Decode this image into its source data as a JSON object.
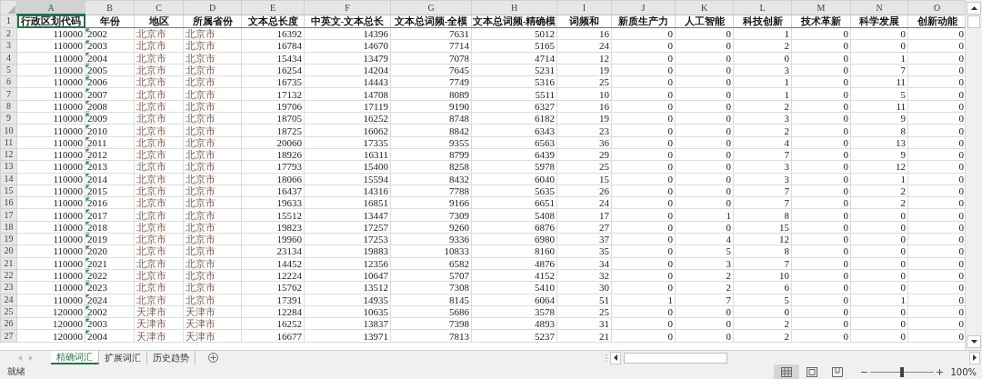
{
  "columns": [
    {
      "letter": "A",
      "selected": true
    },
    {
      "letter": "B",
      "selected": false
    },
    {
      "letter": "C",
      "selected": false
    },
    {
      "letter": "D",
      "selected": false
    },
    {
      "letter": "E",
      "selected": false
    },
    {
      "letter": "F",
      "selected": false
    },
    {
      "letter": "G",
      "selected": false
    },
    {
      "letter": "H",
      "selected": false
    },
    {
      "letter": "I",
      "selected": false
    },
    {
      "letter": "J",
      "selected": false
    },
    {
      "letter": "K",
      "selected": false
    },
    {
      "letter": "L",
      "selected": false
    },
    {
      "letter": "M",
      "selected": false
    },
    {
      "letter": "N",
      "selected": false
    },
    {
      "letter": "O",
      "selected": false
    }
  ],
  "header_row": {
    "num": "1",
    "cells": [
      "行政区划代码",
      "年份",
      "地区",
      "所属省份",
      "文本总长度",
      "中英文-文本总长",
      "文本总词频-全模",
      "文本总词频-精确模",
      "词频和",
      "新质生产力",
      "人工智能",
      "科技创新",
      "技术革新",
      "科学发展",
      "创新动能"
    ]
  },
  "rows": [
    {
      "num": "2",
      "cells": [
        "110000",
        "2002",
        "北京市",
        "北京市",
        "16392",
        "14396",
        "7631",
        "5012",
        "16",
        "0",
        "0",
        "1",
        "0",
        "0",
        "0"
      ]
    },
    {
      "num": "3",
      "cells": [
        "110000",
        "2003",
        "北京市",
        "北京市",
        "16784",
        "14670",
        "7714",
        "5165",
        "24",
        "0",
        "0",
        "2",
        "0",
        "0",
        "0"
      ]
    },
    {
      "num": "4",
      "cells": [
        "110000",
        "2004",
        "北京市",
        "北京市",
        "15434",
        "13479",
        "7078",
        "4714",
        "12",
        "0",
        "0",
        "0",
        "0",
        "1",
        "0"
      ]
    },
    {
      "num": "5",
      "cells": [
        "110000",
        "2005",
        "北京市",
        "北京市",
        "16254",
        "14204",
        "7645",
        "5231",
        "19",
        "0",
        "0",
        "3",
        "0",
        "7",
        "0"
      ]
    },
    {
      "num": "6",
      "cells": [
        "110000",
        "2006",
        "北京市",
        "北京市",
        "16735",
        "14443",
        "7749",
        "5316",
        "25",
        "0",
        "0",
        "1",
        "0",
        "11",
        "0"
      ]
    },
    {
      "num": "7",
      "cells": [
        "110000",
        "2007",
        "北京市",
        "北京市",
        "17132",
        "14708",
        "8089",
        "5511",
        "10",
        "0",
        "0",
        "1",
        "0",
        "5",
        "0"
      ]
    },
    {
      "num": "8",
      "cells": [
        "110000",
        "2008",
        "北京市",
        "北京市",
        "19706",
        "17119",
        "9190",
        "6327",
        "16",
        "0",
        "0",
        "2",
        "0",
        "11",
        "0"
      ]
    },
    {
      "num": "9",
      "cells": [
        "110000",
        "2009",
        "北京市",
        "北京市",
        "18705",
        "16252",
        "8748",
        "6182",
        "19",
        "0",
        "0",
        "3",
        "0",
        "9",
        "0"
      ]
    },
    {
      "num": "10",
      "cells": [
        "110000",
        "2010",
        "北京市",
        "北京市",
        "18725",
        "16062",
        "8842",
        "6343",
        "23",
        "0",
        "0",
        "2",
        "0",
        "8",
        "0"
      ]
    },
    {
      "num": "11",
      "cells": [
        "110000",
        "2011",
        "北京市",
        "北京市",
        "20060",
        "17335",
        "9355",
        "6563",
        "36",
        "0",
        "0",
        "4",
        "0",
        "13",
        "0"
      ]
    },
    {
      "num": "12",
      "cells": [
        "110000",
        "2012",
        "北京市",
        "北京市",
        "18926",
        "16311",
        "8799",
        "6439",
        "29",
        "0",
        "0",
        "7",
        "0",
        "9",
        "0"
      ]
    },
    {
      "num": "13",
      "cells": [
        "110000",
        "2013",
        "北京市",
        "北京市",
        "17793",
        "15400",
        "8258",
        "5978",
        "25",
        "0",
        "0",
        "3",
        "0",
        "12",
        "0"
      ]
    },
    {
      "num": "14",
      "cells": [
        "110000",
        "2014",
        "北京市",
        "北京市",
        "18066",
        "15594",
        "8432",
        "6040",
        "15",
        "0",
        "0",
        "3",
        "0",
        "1",
        "0"
      ]
    },
    {
      "num": "15",
      "cells": [
        "110000",
        "2015",
        "北京市",
        "北京市",
        "16437",
        "14316",
        "7788",
        "5635",
        "26",
        "0",
        "0",
        "7",
        "0",
        "2",
        "0"
      ]
    },
    {
      "num": "16",
      "cells": [
        "110000",
        "2016",
        "北京市",
        "北京市",
        "19633",
        "16851",
        "9166",
        "6651",
        "24",
        "0",
        "0",
        "7",
        "0",
        "2",
        "0"
      ]
    },
    {
      "num": "17",
      "cells": [
        "110000",
        "2017",
        "北京市",
        "北京市",
        "15512",
        "13447",
        "7309",
        "5408",
        "17",
        "0",
        "1",
        "8",
        "0",
        "0",
        "0"
      ]
    },
    {
      "num": "18",
      "cells": [
        "110000",
        "2018",
        "北京市",
        "北京市",
        "19823",
        "17257",
        "9260",
        "6876",
        "27",
        "0",
        "0",
        "15",
        "0",
        "0",
        "0"
      ]
    },
    {
      "num": "19",
      "cells": [
        "110000",
        "2019",
        "北京市",
        "北京市",
        "19960",
        "17253",
        "9336",
        "6980",
        "37",
        "0",
        "4",
        "12",
        "0",
        "0",
        "0"
      ]
    },
    {
      "num": "20",
      "cells": [
        "110000",
        "2020",
        "北京市",
        "北京市",
        "23134",
        "19883",
        "10833",
        "8160",
        "35",
        "0",
        "5",
        "8",
        "0",
        "0",
        "0"
      ]
    },
    {
      "num": "21",
      "cells": [
        "110000",
        "2021",
        "北京市",
        "北京市",
        "14452",
        "12356",
        "6582",
        "4876",
        "34",
        "0",
        "3",
        "7",
        "0",
        "0",
        "0"
      ]
    },
    {
      "num": "22",
      "cells": [
        "110000",
        "2022",
        "北京市",
        "北京市",
        "12224",
        "10647",
        "5707",
        "4152",
        "32",
        "0",
        "2",
        "10",
        "0",
        "0",
        "0"
      ]
    },
    {
      "num": "23",
      "cells": [
        "110000",
        "2023",
        "北京市",
        "北京市",
        "15762",
        "13512",
        "7308",
        "5410",
        "30",
        "0",
        "2",
        "6",
        "0",
        "0",
        "0"
      ]
    },
    {
      "num": "24",
      "cells": [
        "110000",
        "2024",
        "北京市",
        "北京市",
        "17391",
        "14935",
        "8145",
        "6064",
        "51",
        "1",
        "7",
        "5",
        "0",
        "1",
        "0"
      ]
    },
    {
      "num": "25",
      "cells": [
        "120000",
        "2002",
        "天津市",
        "天津市",
        "12284",
        "10635",
        "5686",
        "3578",
        "25",
        "0",
        "0",
        "0",
        "0",
        "0",
        "0"
      ]
    },
    {
      "num": "26",
      "cells": [
        "120000",
        "2003",
        "天津市",
        "天津市",
        "16252",
        "13837",
        "7398",
        "4893",
        "31",
        "0",
        "0",
        "2",
        "0",
        "0",
        "0"
      ]
    },
    {
      "num": "27",
      "cells": [
        "120000",
        "2004",
        "天津市",
        "天津市",
        "16677",
        "13971",
        "7813",
        "5237",
        "21",
        "0",
        "0",
        "2",
        "0",
        "0",
        "0"
      ]
    }
  ],
  "sheet_tabs": [
    {
      "label": "精确词汇",
      "selected": true
    },
    {
      "label": "扩展词汇",
      "selected": false
    },
    {
      "label": "历史趋势",
      "selected": false
    }
  ],
  "status_bar": {
    "text": "就绪",
    "views": [
      {
        "kind": "normal",
        "selected": true
      },
      {
        "kind": "page-layout",
        "selected": false
      },
      {
        "kind": "page-break",
        "selected": false
      }
    ],
    "zoom": {
      "level": 0.5,
      "label": "100%"
    }
  }
}
